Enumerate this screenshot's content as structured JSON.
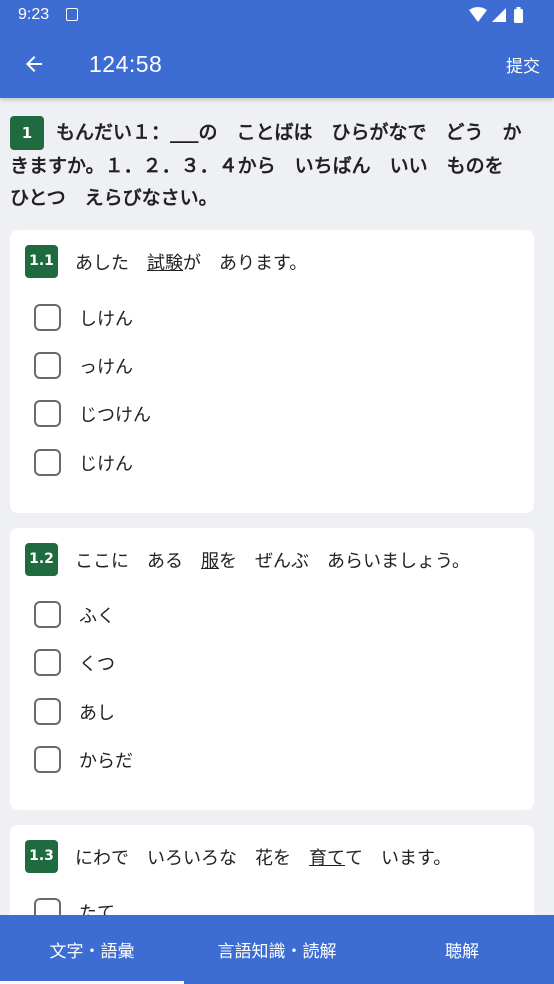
{
  "status_bar": {
    "time": "9:23"
  },
  "app_bar": {
    "title": "124:58",
    "submit_label": "提交"
  },
  "question": {
    "number": "1",
    "text": "もんだい１：___の　ことばは　ひらがなで　どう　かきますか。１．２．３．４から　いちばん　いい　ものを　ひとつ　えらびなさい。"
  },
  "items": [
    {
      "number": "1.1",
      "text_before": "あした　",
      "underlined": "試験",
      "text_after": "が　あります。",
      "options": [
        "しけん",
        "っけん",
        "じつけん",
        "じけん"
      ]
    },
    {
      "number": "1.2",
      "text_before": "ここに　ある　",
      "underlined": "服",
      "text_after": "を　ぜんぶ　あらいましょう。",
      "options": [
        "ふく",
        "くつ",
        "あし",
        "からだ"
      ]
    },
    {
      "number": "1.3",
      "text_before": "にわで　いろいろな　花を　",
      "underlined": "育て",
      "text_after": "て　います。",
      "options": [
        "たて"
      ]
    }
  ],
  "tabs": [
    {
      "label": "文字・語彙",
      "selected": true
    },
    {
      "label": "言語知識・読解",
      "selected": false
    },
    {
      "label": "聴解",
      "selected": false
    }
  ],
  "colors": {
    "primary": "#3d6cd2",
    "badge": "#1f6a3f",
    "background": "#eef0f4"
  }
}
